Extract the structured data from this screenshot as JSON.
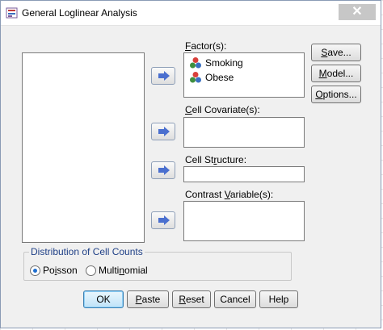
{
  "window": {
    "title": "General Loglinear Analysis",
    "close_glyph": "✕"
  },
  "factors": {
    "label_pre": "",
    "label_u": "F",
    "label_post": "actor(s):",
    "items": [
      {
        "name": "Smoking",
        "icon": "nominal-measure-icon"
      },
      {
        "name": "Obese",
        "icon": "nominal-measure-icon"
      }
    ]
  },
  "cell_covariates": {
    "label_pre": "",
    "label_u": "C",
    "label_post": "ell Covariate(s):"
  },
  "cell_structure": {
    "label_pre": "Cell St",
    "label_u": "r",
    "label_post": "ucture:"
  },
  "contrast_variables": {
    "label_pre": "Contrast ",
    "label_u": "V",
    "label_post": "ariable(s):"
  },
  "side_buttons": {
    "save": {
      "pre": "",
      "u": "S",
      "post": "ave..."
    },
    "model": {
      "pre": "",
      "u": "M",
      "post": "odel..."
    },
    "options": {
      "pre": "",
      "u": "O",
      "post": "ptions..."
    }
  },
  "distribution": {
    "title": "Distribution of Cell Counts",
    "poisson": {
      "pre": "Po",
      "u": "i",
      "post": "sson",
      "selected": true
    },
    "multinomial": {
      "pre": "Multi",
      "u": "n",
      "post": "omial",
      "selected": false
    }
  },
  "bottom_buttons": {
    "ok": {
      "pre": "OK",
      "u": "",
      "post": ""
    },
    "paste": {
      "pre": "",
      "u": "P",
      "post": "aste"
    },
    "reset": {
      "pre": "",
      "u": "R",
      "post": "eset"
    },
    "cancel": {
      "pre": "Cancel",
      "u": "",
      "post": ""
    },
    "help": {
      "pre": "Help",
      "u": "",
      "post": ""
    }
  },
  "colors": {
    "arrow_blue": "#4a6fcf",
    "group_title": "#1e3f86",
    "radio_dot": "#1f6fd0"
  }
}
